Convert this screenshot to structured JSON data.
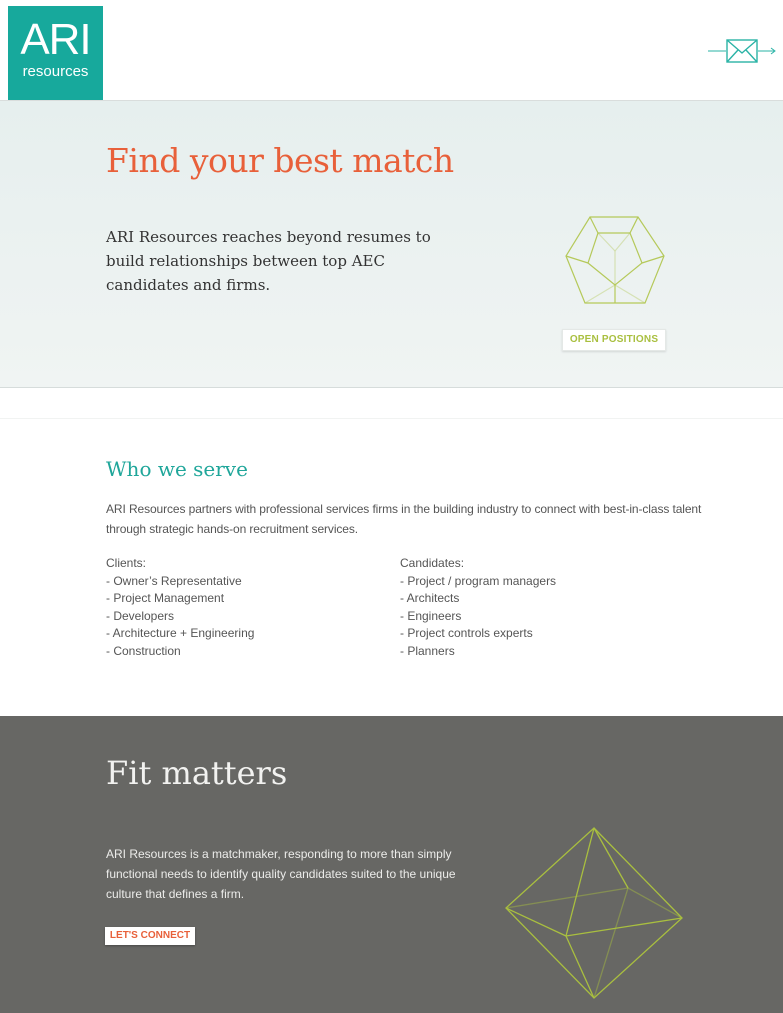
{
  "header": {
    "logo_top": "ARI",
    "logo_bottom": "resources",
    "colors": {
      "logo_bg": "#17a99c",
      "mail_icon": "#2ab3a6"
    },
    "mail_icon": "envelope-icon"
  },
  "hero": {
    "title": "Find your best match",
    "text": "ARI Resources reaches beyond resumes to build relationships between top AEC candidates and firms.",
    "button": "OPEN POSITIONS",
    "colors": {
      "title": "#e8603a",
      "button": "#a9bf3f"
    }
  },
  "serve": {
    "title": "Who we serve",
    "intro": "ARI Resources partners with professional services firms in the building industry to connect with best-in-class talent through strategic hands-on recruitment services.",
    "clients_heading": "Clients:",
    "clients": [
      "- Owner’s Representative",
      "- Project Management",
      "- Developers",
      "- Architecture + Engineering",
      "- Construction"
    ],
    "candidates_heading": "Candidates:",
    "candidates": [
      "- Project / program managers",
      "- Architects",
      "- Engineers",
      "- Project controls experts",
      "- Planners"
    ]
  },
  "fit": {
    "title": "Fit matters",
    "text": "ARI Resources is a matchmaker, responding to more than simply functional needs to identify quality candidates suited to the unique culture that defines a firm.",
    "button": "LET'S CONNECT",
    "colors": {
      "background": "#676764",
      "button_text": "#e8603a",
      "shape": "#a9bf3f"
    }
  }
}
